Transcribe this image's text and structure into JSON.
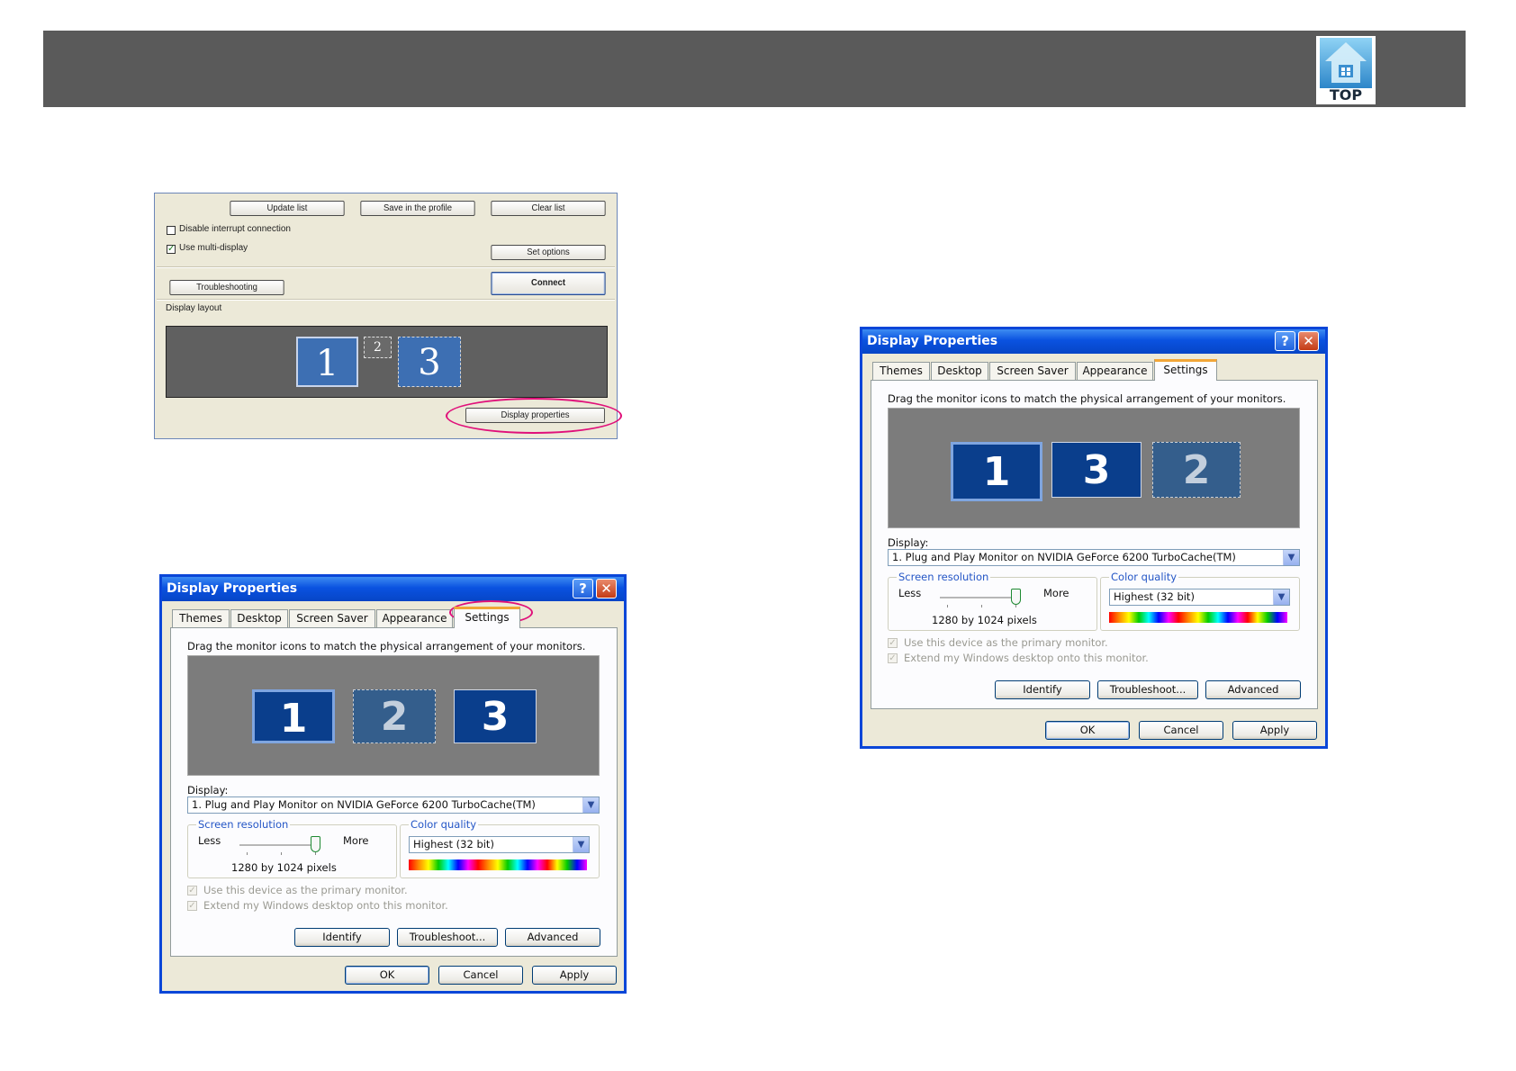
{
  "header": {
    "top_icon_label": "TOP"
  },
  "easymp": {
    "update_list": "Update list",
    "save_profile": "Save in the profile",
    "clear_list": "Clear list",
    "disable_interrupt": "Disable interrupt connection",
    "disable_interrupt_checked": false,
    "use_multi_display": "Use multi-display",
    "use_multi_display_checked": true,
    "set_options": "Set options",
    "troubleshooting": "Troubleshooting",
    "connect": "Connect",
    "display_layout": "Display layout",
    "monitors": [
      "1",
      "2",
      "3"
    ],
    "display_properties": "Display properties"
  },
  "dialog_a": {
    "title": "Display Properties",
    "help": "?",
    "close": "✕",
    "tabs": [
      "Themes",
      "Desktop",
      "Screen Saver",
      "Appearance",
      "Settings"
    ],
    "active_tab": "Settings",
    "instruction": "Drag the monitor icons to match the physical arrangement of your monitors.",
    "monitors": [
      "1",
      "2",
      "3"
    ],
    "display_label": "Display:",
    "display_value": "1. Plug and Play Monitor on NVIDIA GeForce 6200 TurboCache(TM)",
    "screen_resolution": "Screen resolution",
    "less": "Less",
    "more": "More",
    "resolution_value": "1280 by 1024 pixels",
    "color_quality": "Color quality",
    "color_value": "Highest (32 bit)",
    "primary_monitor": "Use this device as the primary monitor.",
    "extend_desktop": "Extend my Windows desktop onto this monitor.",
    "identify": "Identify",
    "troubleshoot": "Troubleshoot...",
    "advanced": "Advanced",
    "ok": "OK",
    "cancel": "Cancel",
    "apply": "Apply"
  },
  "dialog_b": {
    "title": "Display Properties",
    "help": "?",
    "close": "✕",
    "tabs": [
      "Themes",
      "Desktop",
      "Screen Saver",
      "Appearance",
      "Settings"
    ],
    "active_tab": "Settings",
    "instruction": "Drag the monitor icons to match the physical arrangement of your monitors.",
    "monitors": [
      "1",
      "3",
      "2"
    ],
    "display_label": "Display:",
    "display_value": "1. Plug and Play Monitor on NVIDIA GeForce 6200 TurboCache(TM)",
    "screen_resolution": "Screen resolution",
    "less": "Less",
    "more": "More",
    "resolution_value": "1280 by 1024 pixels",
    "color_quality": "Color quality",
    "color_value": "Highest (32 bit)",
    "primary_monitor": "Use this device as the primary monitor.",
    "extend_desktop": "Extend my Windows desktop onto this monitor.",
    "identify": "Identify",
    "troubleshoot": "Troubleshoot...",
    "advanced": "Advanced",
    "ok": "OK",
    "cancel": "Cancel",
    "apply": "Apply"
  },
  "colors": {
    "header_bar": "#5a5a5a",
    "highlight_ellipse": "#e0107a",
    "xp_title_blue": "#0a52e0",
    "monitor_blue": "#0a3e8c"
  }
}
